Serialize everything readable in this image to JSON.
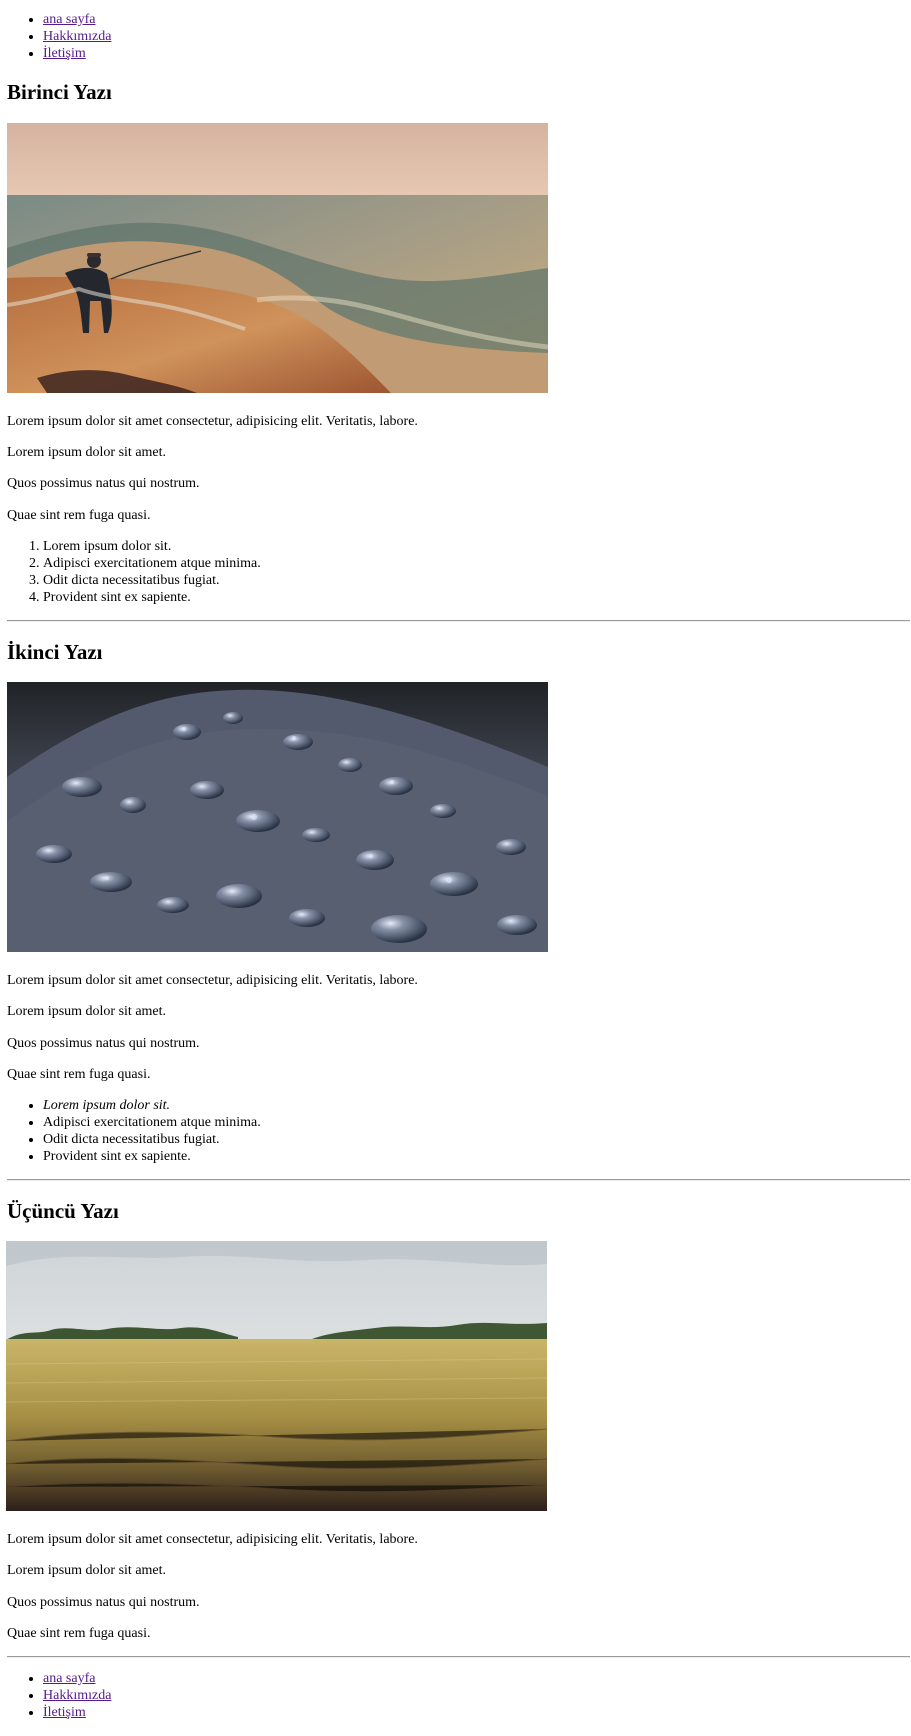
{
  "nav": {
    "items": [
      {
        "label": "ana sayfa"
      },
      {
        "label": "Hakkımızda"
      },
      {
        "label": "İletişim"
      }
    ]
  },
  "posts": [
    {
      "title": "Birinci Yazı",
      "paragraphs": [
        "Lorem ipsum dolor sit amet consectetur, adipisicing elit. Veritatis, labore.",
        "Lorem ipsum dolor sit amet.",
        "Quos possimus natus qui nostrum.",
        "Quae sint rem fuga quasi."
      ],
      "list": [
        "Lorem ipsum dolor sit.",
        "Adipisci exercitationem atque minima.",
        "Odit dicta necessitatibus fugiat.",
        "Provident sint ex sapiente."
      ]
    },
    {
      "title": "İkinci Yazı",
      "paragraphs": [
        "Lorem ipsum dolor sit amet consectetur, adipisicing elit. Veritatis, labore.",
        "Lorem ipsum dolor sit amet.",
        "Quos possimus natus qui nostrum.",
        "Quae sint rem fuga quasi."
      ],
      "list": [
        "Lorem ipsum dolor sit.",
        "Adipisci exercitationem atque minima.",
        "Odit dicta necessitatibus fugiat.",
        "Provident sint ex sapiente."
      ]
    },
    {
      "title": "Üçüncü Yazı",
      "paragraphs": [
        "Lorem ipsum dolor sit amet consectetur, adipisicing elit. Veritatis, labore.",
        "Lorem ipsum dolor sit amet.",
        "Quos possimus natus qui nostrum.",
        "Quae sint rem fuga quasi."
      ]
    }
  ],
  "colors": {
    "link": "#551a8b",
    "text": "#000000",
    "rule": "#9b9b9b",
    "background": "#ffffff"
  }
}
